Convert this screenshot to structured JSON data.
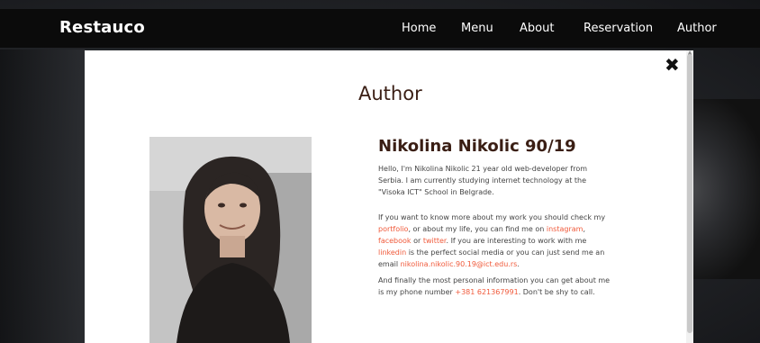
{
  "navbar": {
    "brand": "Restauco",
    "items": [
      "Home",
      "Menu",
      "About",
      "Reservation",
      "Author"
    ]
  },
  "modal": {
    "title": "Author",
    "close_label": "✖",
    "author_name": "Nikolina Nikolic 90/19",
    "p1": "Hello, I'm Nikolina Nikolic 21 year old web-developer from Serbia. I am currently studying internet technology at the \"Visoka ICT\" School in Belgrade.",
    "p2": {
      "t1": "If you want to know more about my work you should check my ",
      "portfolio": "portfolio",
      "t2": ", or about my life, you can find me on ",
      "instagram": "instagram",
      "t3": ", ",
      "facebook": "facebook",
      "t4": " or ",
      "twitter": "twitter",
      "t5": ". If you are interesting to work with me ",
      "linkedin": "linkedin",
      "t6": " is the perfect social media or you can just send me an email ",
      "email": "nikolina.nikolic.90.19@ict.edu.rs",
      "t7": "."
    },
    "p3": {
      "t1": "And finally the most personal information you can get about me is my phone number ",
      "phone": "+381 621367991",
      "t2": ". Don't be shy to call."
    }
  },
  "colors": {
    "navbar_bg": "#0b0b0b",
    "title": "#3a1e14",
    "link": "#f05a3b"
  }
}
